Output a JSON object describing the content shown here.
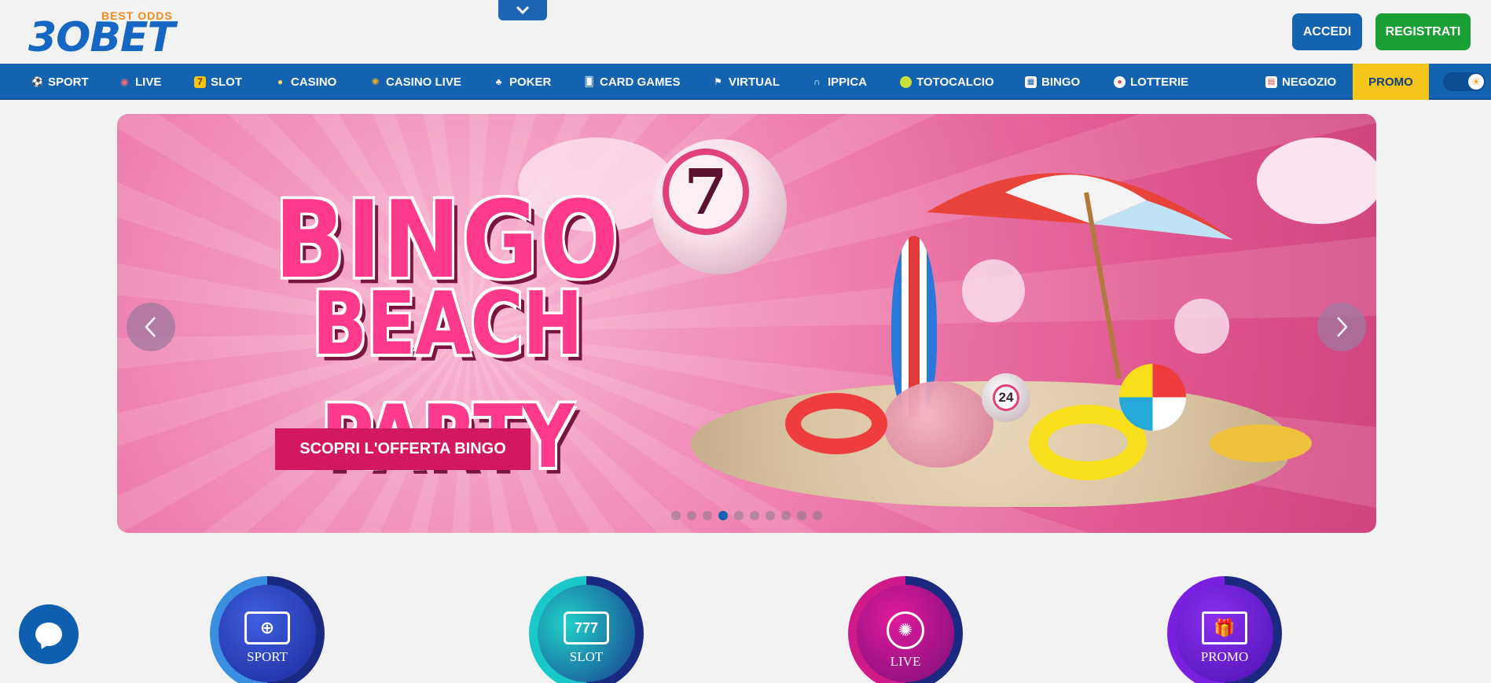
{
  "header": {
    "logo_tagline": "BEST ODDS",
    "logo_name": "3OBET",
    "login_label": "ACCEDI",
    "register_label": "REGISTRATI"
  },
  "nav": {
    "items": [
      {
        "label": "SPORT",
        "icon": "soccer-ball-icon"
      },
      {
        "label": "LIVE",
        "icon": "live-signal-icon"
      },
      {
        "label": "SLOT",
        "icon": "slot-machine-icon"
      },
      {
        "label": "CASINO",
        "icon": "casino-chips-icon"
      },
      {
        "label": "CASINO LIVE",
        "icon": "roulette-icon"
      },
      {
        "label": "POKER",
        "icon": "poker-icon"
      },
      {
        "label": "CARD GAMES",
        "icon": "cards-icon"
      },
      {
        "label": "VIRTUAL",
        "icon": "checkered-flag-icon"
      },
      {
        "label": "IPPICA",
        "icon": "horseshoe-icon"
      },
      {
        "label": "TOTOCALCIO",
        "icon": "tennis-ball-icon"
      },
      {
        "label": "BINGO",
        "icon": "bingo-card-icon"
      },
      {
        "label": "LOTTERIE",
        "icon": "lottery-ball-icon"
      },
      {
        "label": "NEGOZIO",
        "icon": "shop-icon"
      }
    ],
    "promo_label": "PROMO",
    "theme_toggle_icon": "sun-icon"
  },
  "banner": {
    "title_line1": "BINGO",
    "title_line2": "BEACH PARTY",
    "cta_label": "SCOPRI L'OFFERTA BINGO",
    "ball_number": "7",
    "small_ball_number": "24",
    "slide_count": 10,
    "active_slide": 4
  },
  "categories": [
    {
      "label": "SPORT",
      "icon": "soccer-field-icon"
    },
    {
      "label": "SLOT",
      "icon": "slot-777-icon"
    },
    {
      "label": "LIVE",
      "icon": "roulette-chip-icon"
    },
    {
      "label": "PROMO",
      "icon": "gift-icon"
    }
  ],
  "colors": {
    "brand_blue": "#1463b0",
    "register_green": "#18a035",
    "promo_yellow": "#f5c419",
    "banner_pink": "#e0558f"
  }
}
